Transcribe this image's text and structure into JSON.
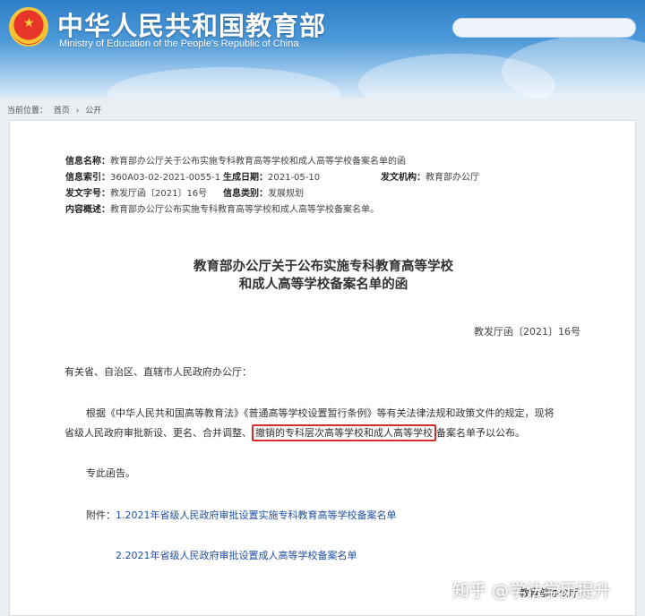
{
  "header": {
    "title": "中华人民共和国教育部",
    "subtitle": "Ministry of Education of the People's Republic of China",
    "search_placeholder": ""
  },
  "breadcrumb": {
    "label": "当前位置：",
    "items": [
      "首页",
      "›",
      "公开"
    ]
  },
  "meta": {
    "info_name_key": "信息名称：",
    "info_name_val": "教育部办公厅关于公布实施专科教育高等学校和成人高等学校备案名单的函",
    "info_index_key": "信息索引：",
    "info_index_val": "360A03-02-2021-0055-1",
    "generated_key": "生成日期：",
    "generated_val": "2021-05-10",
    "issuer_key": "发文机构：",
    "issuer_val": "教育部办公厅",
    "doc_no_key": "发文字号：",
    "doc_no_val": "教发厅函〔2021〕16号",
    "category_key": "信息类别：",
    "category_val": "发展规划",
    "summary_key": "内容概述：",
    "summary_val": "教育部办公厅公布实施专科教育高等学校和成人高等学校备案名单。"
  },
  "document": {
    "title_line1": "教育部办公厅关于公布实施专科教育高等学校",
    "title_line2": "和成人高等学校备案名单的函",
    "number": "教发厅函〔2021〕16号",
    "salutation": "有关省、自治区、直辖市人民政府办公厅：",
    "body_line1": "根据《中华人民共和国高等教育法》《普通高等学校设置暂行条例》等有关法律法规和政策文件的规定，现将",
    "body_line2_pre": "省级人民政府审批新设、更名、合并调整、",
    "body_line2_hl": "撤销的专科层次高等学校和成人高等学校",
    "body_line2_post": "备案名单予以公布。",
    "closing": "专此函告。",
    "attachment_label": "附件：",
    "attachment_1": "1.2021年省级人民政府审批设置实施专科教育高等学校备案名单",
    "attachment_2": "2.2021年省级人民政府审批设置成人高等学校备案名单",
    "sender": "教育部办公厅"
  },
  "watermark": "知乎 @学法学历提升",
  "colors": {
    "accent_red": "#d92b2b",
    "link_blue": "#1f4fa3",
    "header_blue": "#2f7fc9"
  }
}
